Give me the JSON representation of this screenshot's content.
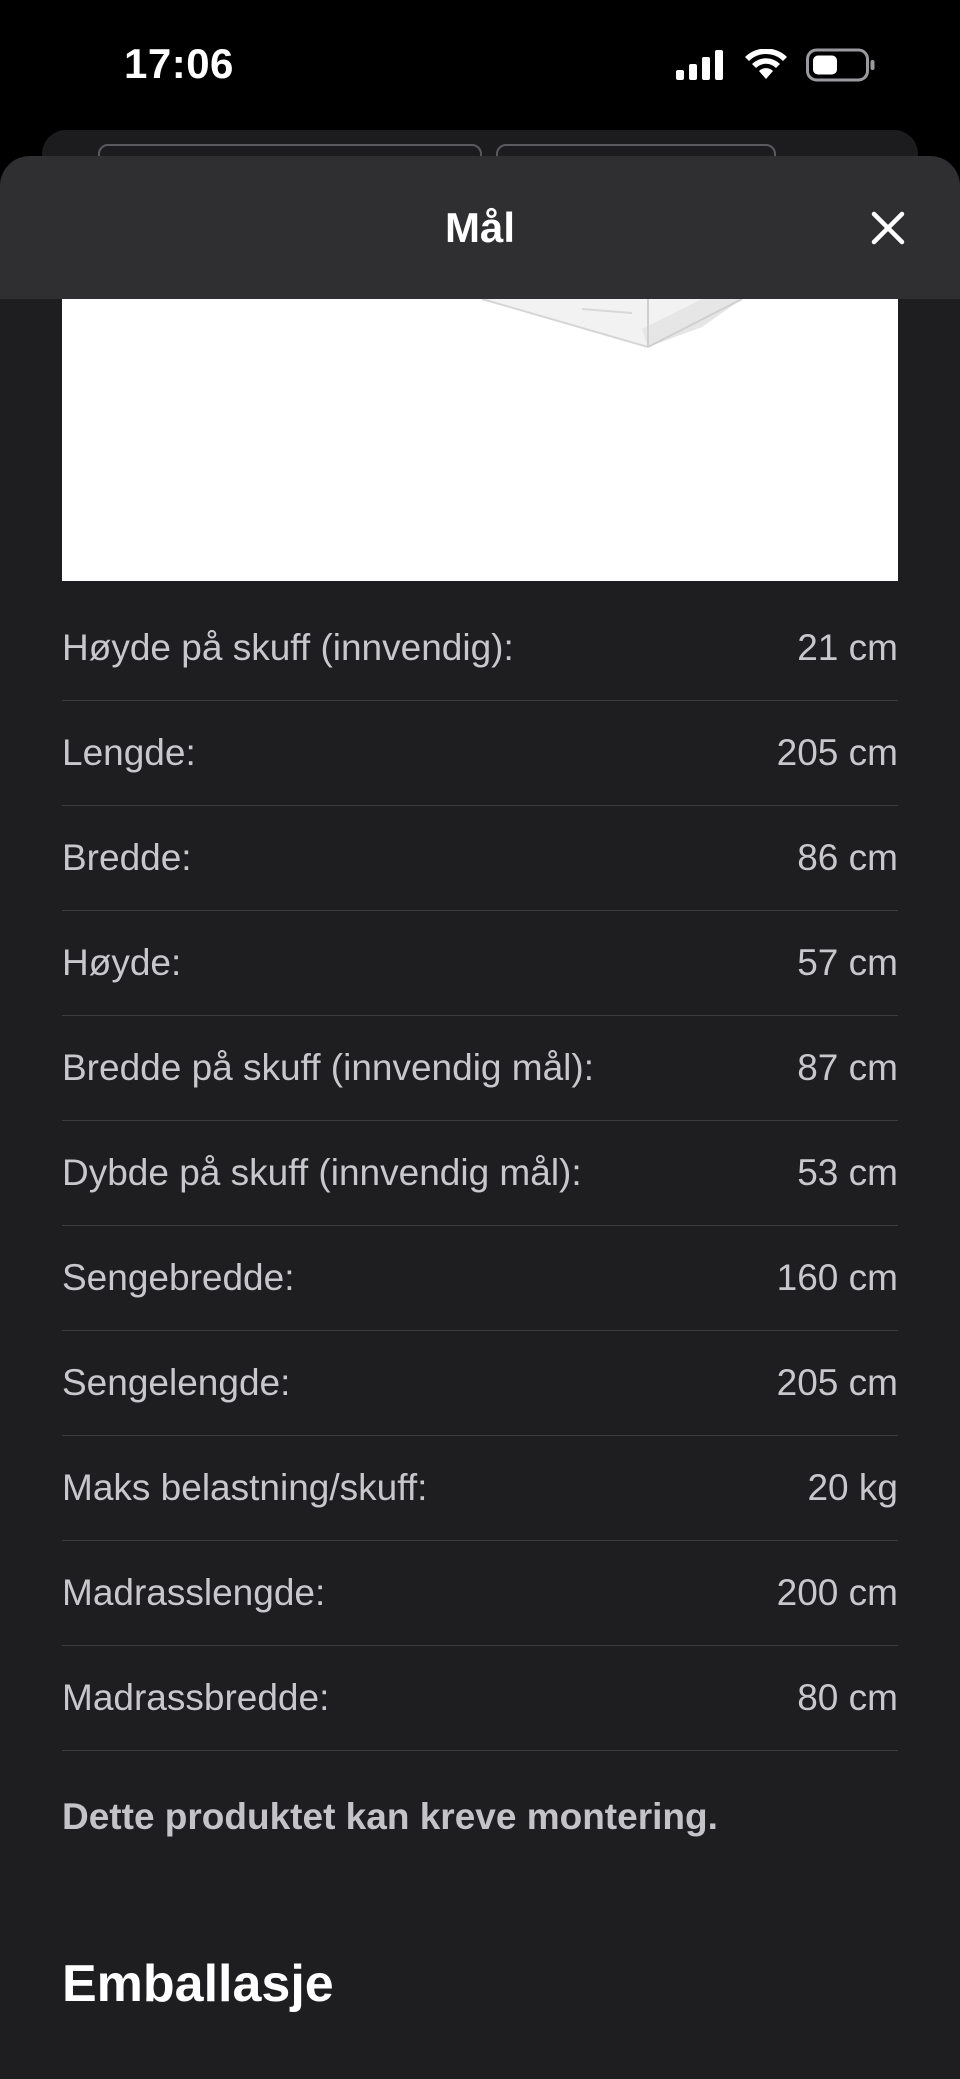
{
  "status_bar": {
    "time": "17:06"
  },
  "sheet": {
    "title": "Mål",
    "close_icon": "close-icon"
  },
  "dimensions": [
    {
      "label": "Høyde på skuff (innvendig):",
      "value": "21 cm"
    },
    {
      "label": "Lengde:",
      "value": "205 cm"
    },
    {
      "label": "Bredde:",
      "value": "86 cm"
    },
    {
      "label": "Høyde:",
      "value": "57 cm"
    },
    {
      "label": "Bredde på skuff (innvendig mål):",
      "value": "87 cm"
    },
    {
      "label": "Dybde på skuff (innvendig mål):",
      "value": "53 cm"
    },
    {
      "label": "Sengebredde:",
      "value": "160 cm"
    },
    {
      "label": "Sengelengde:",
      "value": "205 cm"
    },
    {
      "label": "Maks belastning/skuff:",
      "value": "20 kg"
    },
    {
      "label": "Madrasslengde:",
      "value": "200 cm"
    },
    {
      "label": "Madrassbredde:",
      "value": "80 cm"
    }
  ],
  "assembly_note": "Dette produktet kan kreve montering.",
  "section_heading": "Emballasje",
  "colors": {
    "sheet_background": "#1e1e20",
    "header_background": "#2f2f31",
    "divider": "#3c3c3e",
    "text_primary": "#ffffff",
    "text_secondary": "#c8c8cc"
  }
}
